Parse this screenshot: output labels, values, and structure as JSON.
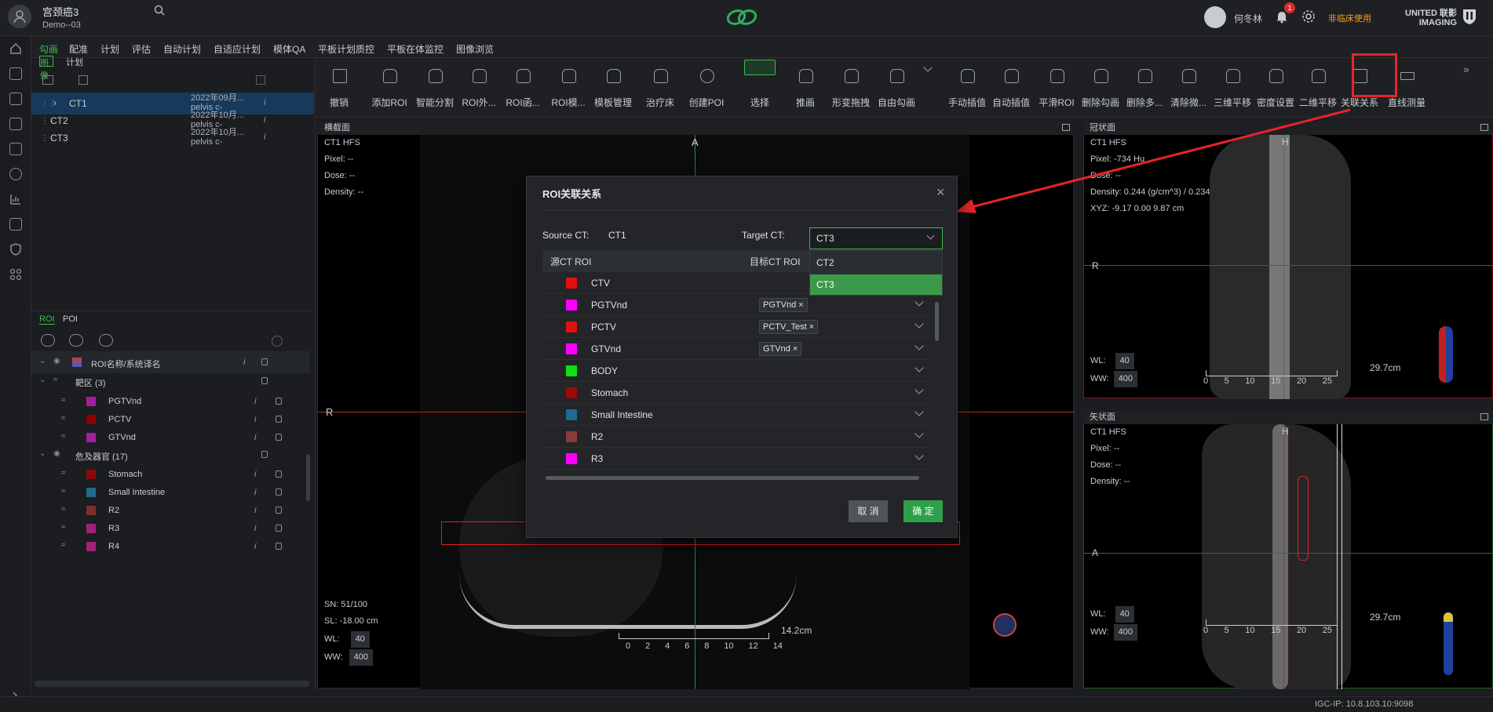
{
  "header": {
    "patient_name": "宫颈癌3",
    "patient_id": "Demo--03",
    "user_name": "何冬林",
    "notification_count": "1",
    "non_clinical": "非临床使用",
    "brand_line1": "UNITED 联影",
    "brand_line2": "IMAGING"
  },
  "nav_tabs": [
    "勾画",
    "配准",
    "计划",
    "评估",
    "自动计划",
    "自适应计划",
    "模体QA",
    "平板计划质控",
    "平板在体监控",
    "图像浏览"
  ],
  "left_panel": {
    "sub_tabs": [
      "图像",
      "计划"
    ],
    "plans": [
      {
        "name": "CT1",
        "date": "2022年09月...",
        "desc": "pelvis c-"
      },
      {
        "name": "CT2",
        "date": "2022年10月...",
        "desc": "pelvis c-"
      },
      {
        "name": "CT3",
        "date": "2022年10月...",
        "desc": "pelvis c-"
      }
    ],
    "roi_tabs": [
      "ROI",
      "POI"
    ],
    "roi_header": "ROI名称/系统译名",
    "group_targets": "靶区 (3)",
    "group_oar": "危及器官 (17)",
    "rois": [
      {
        "name": "PGTVnd",
        "color": "#a020a0"
      },
      {
        "name": "PCTV",
        "color": "#8b0000"
      },
      {
        "name": "GTVnd",
        "color": "#a020a0"
      },
      {
        "name": "Stomach",
        "color": "#8b0a0a"
      },
      {
        "name": "Small Intestine",
        "color": "#1f6a8f"
      },
      {
        "name": "R2",
        "color": "#7a3030"
      },
      {
        "name": "R3",
        "color": "#a0207a"
      },
      {
        "name": "R4",
        "color": "#a0207a"
      }
    ]
  },
  "toolbar": [
    "撤销",
    "添加ROI",
    "智能分割",
    "ROI外...",
    "ROI函...",
    "ROI模...",
    "模板管理",
    "治疗床",
    "创建POI",
    "选择",
    "推画",
    "形变拖拽",
    "自由勾画",
    "手动插值",
    "自动插值",
    "平滑ROI",
    "删除勾画",
    "删除多...",
    "清除微...",
    "三维平移",
    "密度设置",
    "二维平移",
    "关联关系",
    "直线测量"
  ],
  "views": {
    "axial": {
      "title": "横截面",
      "l1": "CT1 HFS",
      "l2": "Pixel: --",
      "l3": "Dose: --",
      "l4": "Density: --",
      "sn": "SN: 51/100",
      "sl": "SL: -18.00 cm",
      "wl_label": "WL:",
      "wl": "40",
      "ww_label": "WW:",
      "ww": "400",
      "ant": "A",
      "right": "R",
      "scale": "14.2cm",
      "ticks": [
        "0",
        "2",
        "4",
        "6",
        "8",
        "10",
        "12",
        "14"
      ]
    },
    "coronal": {
      "title": "冠状面",
      "l1": "CT1 HFS",
      "l2": "Pixel: -734 Hu",
      "l3": "Dose: --",
      "l4": "Density: 0.244 (g/cm^3) / 0.234",
      "l5": "XYZ: -9.17 0.00 9.87 cm",
      "wl_label": "WL:",
      "wl": "40",
      "ww_label": "WW:",
      "ww": "400",
      "head": "H",
      "right": "R",
      "scale": "29.7cm",
      "ticks": [
        "0",
        "5",
        "10",
        "15",
        "20",
        "25"
      ]
    },
    "sagittal": {
      "title": "矢状面",
      "l1": "CT1 HFS",
      "l2": "Pixel: --",
      "l3": "Dose: --",
      "l4": "Density: --",
      "wl_label": "WL:",
      "wl": "40",
      "ww_label": "WW:",
      "ww": "400",
      "head": "H",
      "ant": "A",
      "scale": "29.7cm",
      "ticks": [
        "0",
        "5",
        "10",
        "15",
        "20",
        "25"
      ]
    }
  },
  "dialog": {
    "title": "ROI关联关系",
    "source_label": "Source CT:",
    "source_value": "CT1",
    "target_label": "Target CT:",
    "target_value": "CT3",
    "options": [
      "CT2",
      "CT3"
    ],
    "col_source": "源CT ROI",
    "col_target": "目标CT ROI",
    "rows": [
      {
        "name": "CTV",
        "color": "#e01010",
        "target": ""
      },
      {
        "name": "PGTVnd",
        "color": "#ff00ff",
        "target": "PGTVnd"
      },
      {
        "name": "PCTV",
        "color": "#e01010",
        "target": "PCTV_Test"
      },
      {
        "name": "GTVnd",
        "color": "#ff00ff",
        "target": "GTVnd"
      },
      {
        "name": "BODY",
        "color": "#10e010",
        "target": ""
      },
      {
        "name": "Stomach",
        "color": "#9a0a0a",
        "target": ""
      },
      {
        "name": "Small Intestine",
        "color": "#1f6a8f",
        "target": ""
      },
      {
        "name": "R2",
        "color": "#8a3a3a",
        "target": ""
      },
      {
        "name": "R3",
        "color": "#ff00ff",
        "target": ""
      }
    ],
    "cancel": "取 消",
    "ok": "确 定"
  },
  "status_bar": "IGC-IP: 10.8.103.10:9098"
}
